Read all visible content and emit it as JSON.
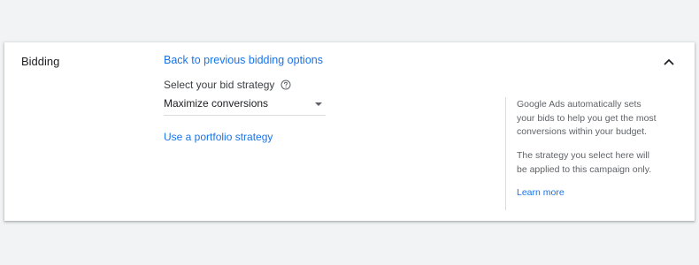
{
  "section": {
    "title": "Bidding"
  },
  "bidding": {
    "back_link": "Back to previous bidding options",
    "strategy_label": "Select your bid strategy",
    "selected_strategy": "Maximize conversions",
    "portfolio_link": "Use a portfolio strategy"
  },
  "info": {
    "paragraph_1": "Google Ads automatically sets your bids to help you get the most conversions within your budget.",
    "paragraph_2": "The strategy you select here will be applied to this campaign only.",
    "learn_more": "Learn more"
  },
  "icons": {
    "collapse": "chevron-up-icon",
    "help": "help-circle-icon",
    "dropdown": "dropdown-arrow-icon"
  },
  "colors": {
    "link": "#1a73e8",
    "background": "#f1f3f4",
    "card": "#ffffff"
  }
}
